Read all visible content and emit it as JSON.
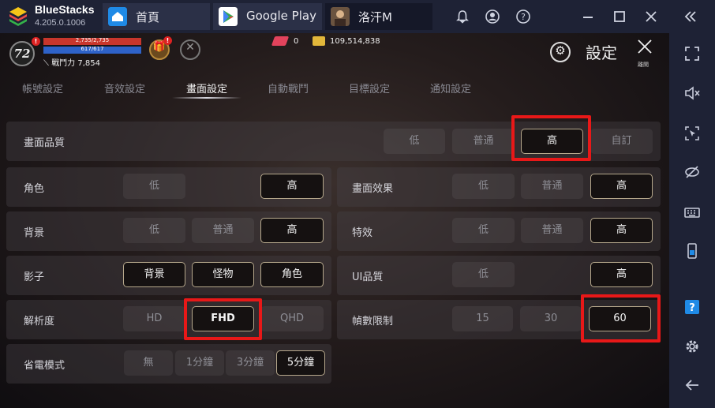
{
  "bluestacks": {
    "name": "BlueStacks",
    "version": "4.205.0.1006",
    "tabs": [
      {
        "label": "首頁",
        "icon": "home-icon"
      },
      {
        "label": "Google Play",
        "icon": "google-play-icon"
      },
      {
        "label": "洛汗M",
        "icon": "game-avatar-icon"
      }
    ],
    "accent": "#1f8ae6"
  },
  "window_controls": [
    "bell-icon",
    "account-icon",
    "help-icon",
    "minimize-icon",
    "maximize-icon",
    "close-icon",
    "collapse-sidebar-icon"
  ],
  "sidebar": [
    "fullscreen-icon",
    "volume-mute-icon",
    "screenshot-cursor-icon",
    "hide-eye-icon",
    "keyboard-icon",
    "phone-icon",
    "question-icon",
    "gear-icon",
    "back-arrow-icon"
  ],
  "hud": {
    "level": "72",
    "hp": "2,735/2,735",
    "hp_fraction": 1.0,
    "mp": "617/617",
    "mp_fraction": 1.0,
    "power_label": "戰鬥力",
    "power_value": "7,854",
    "gems": "0",
    "gold": "109,514,838"
  },
  "header": {
    "title": "設定",
    "close_label": "離開"
  },
  "setting_tabs": [
    "帳號設定",
    "音效設定",
    "畫面設定",
    "自動戰鬥",
    "目標設定",
    "通知設定"
  ],
  "active_tab": "畫面設定",
  "settings": {
    "quality": {
      "label": "畫面品質",
      "options": [
        "低",
        "普通",
        "高",
        "自訂"
      ],
      "selected": "高"
    },
    "character": {
      "label": "角色",
      "options": [
        "低",
        "高"
      ],
      "selected": "高"
    },
    "screen_effect": {
      "label": "畫面效果",
      "options": [
        "低",
        "普通",
        "高"
      ],
      "selected": "高"
    },
    "background": {
      "label": "背景",
      "options": [
        "低",
        "普通",
        "高"
      ],
      "selected": "高"
    },
    "special_effect": {
      "label": "特效",
      "options": [
        "低",
        "普通",
        "高"
      ],
      "selected": "高"
    },
    "shadow": {
      "label": "影子",
      "options": [
        "背景",
        "怪物",
        "角色"
      ],
      "selected": [
        "背景",
        "怪物",
        "角色"
      ]
    },
    "ui_quality": {
      "label": "UI品質",
      "options": [
        "低",
        "高"
      ],
      "selected": "高"
    },
    "resolution": {
      "label": "解析度",
      "options": [
        "HD",
        "FHD",
        "QHD"
      ],
      "selected": "FHD"
    },
    "frame_limit": {
      "label": "幀數限制",
      "options": [
        "15",
        "30",
        "60"
      ],
      "selected": "60"
    },
    "power_save": {
      "label": "省電模式",
      "options": [
        "無",
        "1分鐘",
        "3分鐘",
        "5分鐘"
      ],
      "selected": "5分鐘"
    }
  },
  "highlight_color": "#e81818"
}
